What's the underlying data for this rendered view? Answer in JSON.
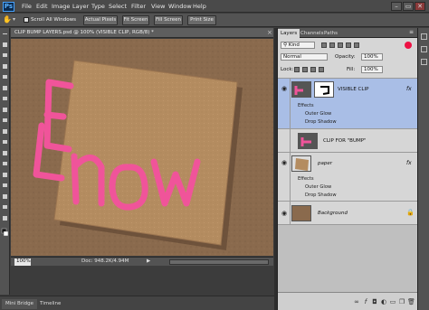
{
  "app": {
    "logo": "Ps"
  },
  "menu": [
    "File",
    "Edit",
    "Image",
    "Layer",
    "Type",
    "Select",
    "Filter",
    "View",
    "Window",
    "Help"
  ],
  "window_buttons": [
    "–",
    "▭",
    "✕"
  ],
  "options_bar": {
    "scroll_all_label": "Scroll All Windows",
    "buttons": [
      "Actual Pixels",
      "Fit Screen",
      "Fill Screen",
      "Print Size"
    ]
  },
  "document": {
    "tab_title": "CLIP BUMP LAYERS.psd @ 100% (VISIBLE CLIP, RGB/8) *",
    "zoom": "100%",
    "doc_info": "Doc: 948.2K/4.94M",
    "canvas_colors": {
      "board": "#8a6a4d",
      "paper": "#b48c60",
      "pink": "#f0549a"
    }
  },
  "bottom_tabs": [
    "Mini Bridge",
    "Timeline"
  ],
  "layers_panel": {
    "tabs": [
      "Layers",
      "Channels",
      "Paths"
    ],
    "kind_label": "Kind",
    "blend_mode": "Normal",
    "opacity_label": "Opacity:",
    "opacity_value": "100%",
    "lock_label": "Lock:",
    "fill_label": "Fill:",
    "fill_value": "100%",
    "layers": [
      {
        "name": "VISIBLE CLIP",
        "fx": "fx",
        "effects_label": "Effects",
        "effects": [
          "Outer Glow",
          "Drop Shadow"
        ]
      },
      {
        "name": "CLIP FOR \"BUMP\""
      },
      {
        "name": "paper",
        "fx": "fx",
        "effects_label": "Effects",
        "effects": [
          "Outer Glow",
          "Drop Shadow"
        ]
      },
      {
        "name": "Background"
      }
    ]
  }
}
